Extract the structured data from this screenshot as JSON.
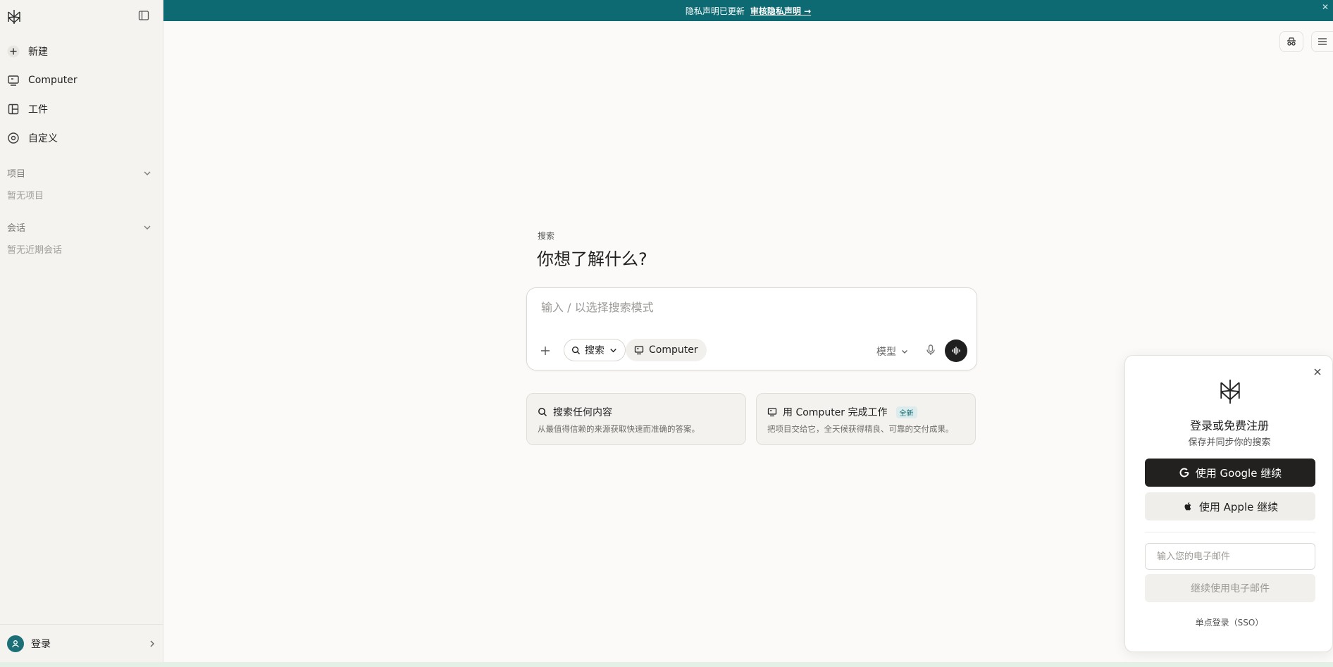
{
  "banner": {
    "text": "隐私声明已更新",
    "link": "审核隐私声明 →"
  },
  "sidebar": {
    "items": [
      {
        "label": "新建",
        "icon": "plus-icon"
      },
      {
        "label": "Computer",
        "icon": "computer-icon"
      },
      {
        "label": "工件",
        "icon": "artifact-icon"
      },
      {
        "label": "自定义",
        "icon": "customize-icon"
      }
    ],
    "projects": {
      "title": "项目",
      "empty": "暂无项目"
    },
    "sessions": {
      "title": "会话",
      "empty": "暂无近期会话"
    },
    "signin_label": "登录"
  },
  "main": {
    "kicker": "搜索",
    "heading": "你想了解什么?",
    "composer": {
      "placeholder": "输入 / 以选择搜索模式",
      "search_label": "搜索",
      "computer_label": "Computer",
      "model_label": "模型"
    },
    "cards": [
      {
        "title": "搜索任何内容",
        "desc": "从最值得信赖的来源获取快速而准确的答案。",
        "badge": ""
      },
      {
        "title": "用 Computer 完成工作",
        "desc": "把项目交给它，全天候获得精良、可靠的交付成果。",
        "badge": "全新"
      }
    ]
  },
  "login": {
    "title": "登录或免费注册",
    "subtitle": "保存并同步你的搜索",
    "google": "使用 Google 继续",
    "apple": "使用 Apple 继续",
    "email_placeholder": "输入您的电子邮件",
    "email_button": "继续使用电子邮件",
    "sso": "单点登录（SSO）"
  },
  "colors": {
    "accent": "#0d6a72",
    "dark": "#22211f"
  }
}
